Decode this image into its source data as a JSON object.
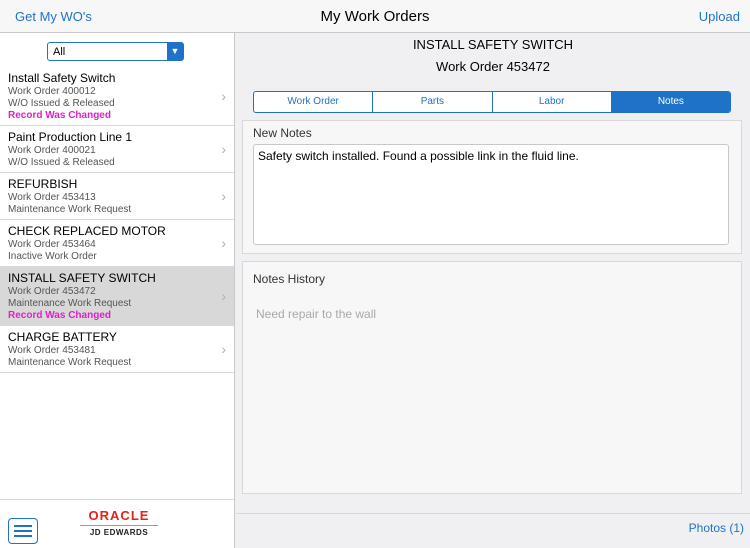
{
  "navbar": {
    "left_label": "Get My WO's",
    "title": "My Work Orders",
    "right_label": "Upload"
  },
  "sidebar": {
    "filter": {
      "selected": "All"
    },
    "items": [
      {
        "title": "Install Safety Switch",
        "number": "Work Order 400012",
        "status": "W/O Issued & Released",
        "flag": "Record Was Changed"
      },
      {
        "title": "Paint Production Line 1",
        "number": "Work Order 400021",
        "status": "W/O Issued & Released",
        "flag": ""
      },
      {
        "title": "REFURBISH",
        "number": "Work Order 453413",
        "status": "Maintenance Work Request",
        "flag": ""
      },
      {
        "title": "CHECK REPLACED MOTOR",
        "number": "Work Order 453464",
        "status": "Inactive Work Order",
        "flag": ""
      },
      {
        "title": "INSTALL SAFETY SWITCH",
        "number": "Work Order 453472",
        "status": "Maintenance Work Request",
        "flag": "Record Was Changed"
      },
      {
        "title": "CHARGE BATTERY",
        "number": "Work Order 453481",
        "status": "Maintenance Work Request",
        "flag": ""
      }
    ],
    "selected_index": 4,
    "logo": {
      "brand": "ORACLE",
      "product": "JD EDWARDS"
    }
  },
  "main": {
    "title": "INSTALL SAFETY SWITCH",
    "subtitle": "Work Order 453472",
    "tabs": [
      {
        "label": "Work Order"
      },
      {
        "label": "Parts"
      },
      {
        "label": "Labor"
      },
      {
        "label": "Notes"
      }
    ],
    "active_tab": "Notes",
    "new_notes": {
      "label": "New Notes",
      "value": "Safety switch installed.  Found a possible link in the fluid line."
    },
    "notes_history": {
      "label": "Notes History",
      "text": "Need repair to the wall"
    }
  },
  "bottom": {
    "photos_label": "Photos (1)"
  },
  "colors": {
    "accent": "#1e72c8",
    "changed_flag": "#e020c8",
    "selected_row": "#d8d8d8",
    "oracle_red": "#e2231a"
  }
}
